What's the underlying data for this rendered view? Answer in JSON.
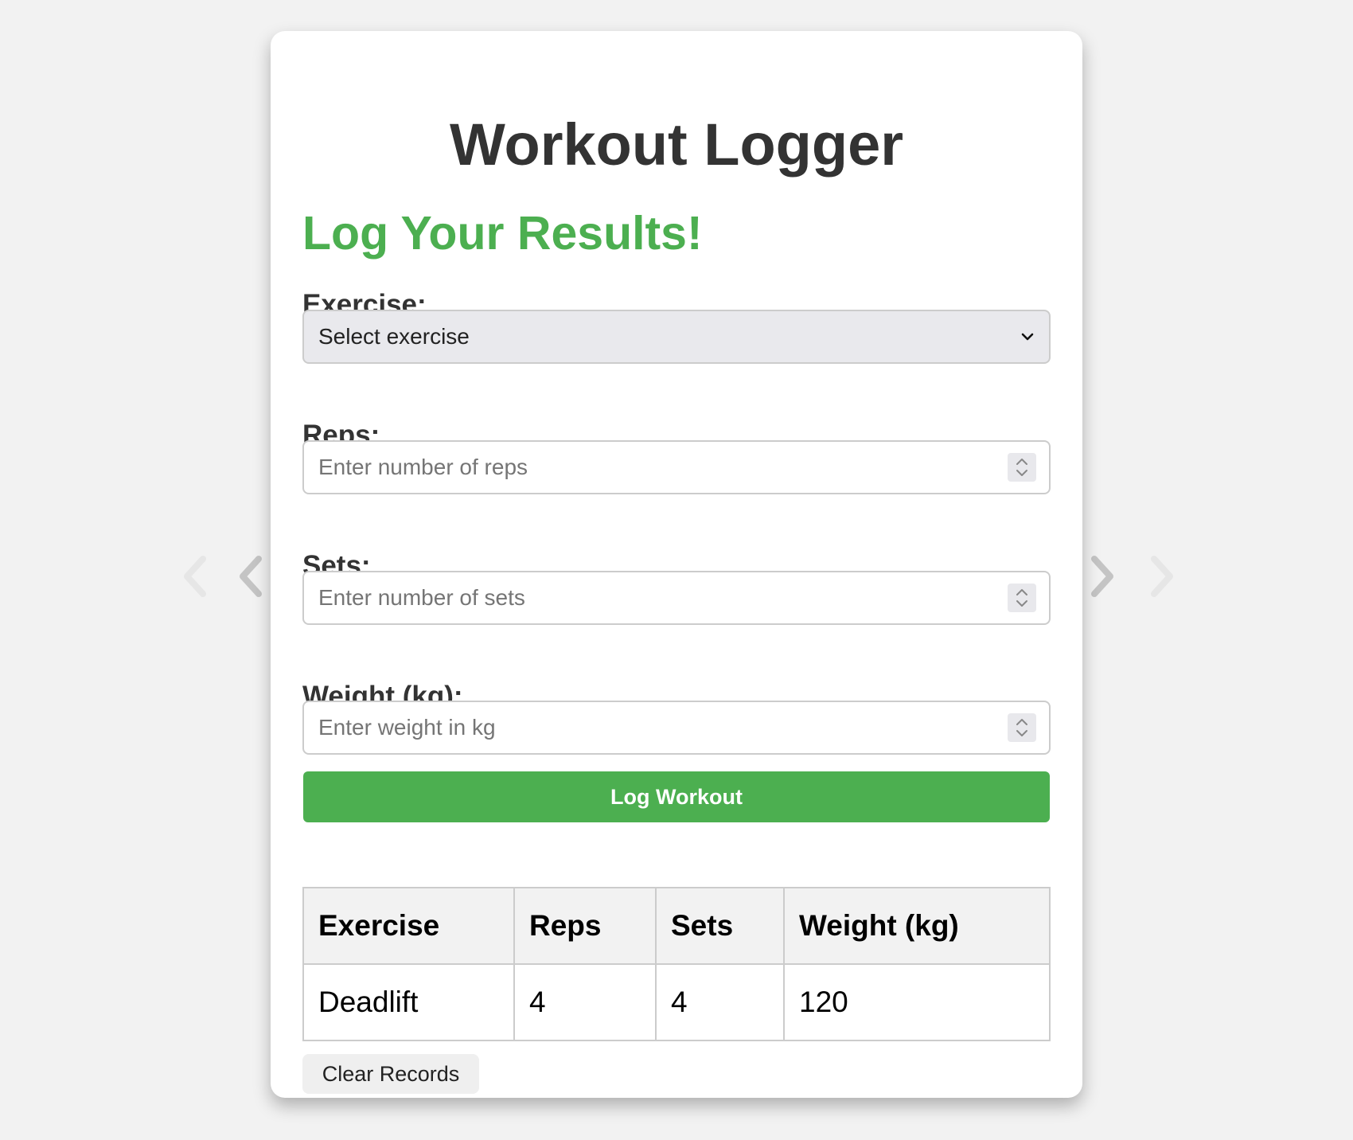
{
  "colors": {
    "accent_green": "#4caf50",
    "page_background": "#f2f2f2",
    "card_background": "#ffffff",
    "text_dark": "#333333"
  },
  "header": {
    "title": "Workout Logger",
    "subtitle": "Log Your Results!"
  },
  "form": {
    "exercise": {
      "label": "Exercise:",
      "selected": "Select exercise"
    },
    "reps": {
      "label": "Reps:",
      "placeholder": "Enter number of reps"
    },
    "sets": {
      "label": "Sets:",
      "placeholder": "Enter number of sets"
    },
    "weight": {
      "label": "Weight (kg):",
      "placeholder": "Enter weight in kg"
    },
    "submit_label": "Log Workout"
  },
  "records": {
    "columns": [
      "Exercise",
      "Reps",
      "Sets",
      "Weight (kg)"
    ],
    "rows": [
      [
        "Deadlift",
        "4",
        "4",
        "120"
      ]
    ],
    "clear_label": "Clear Records"
  },
  "icons": {
    "select_arrow": "chevron-down-icon",
    "number_spinner": "spinner-icon",
    "prev_nav": "chevron-left-icon",
    "next_nav": "chevron-right-icon"
  }
}
